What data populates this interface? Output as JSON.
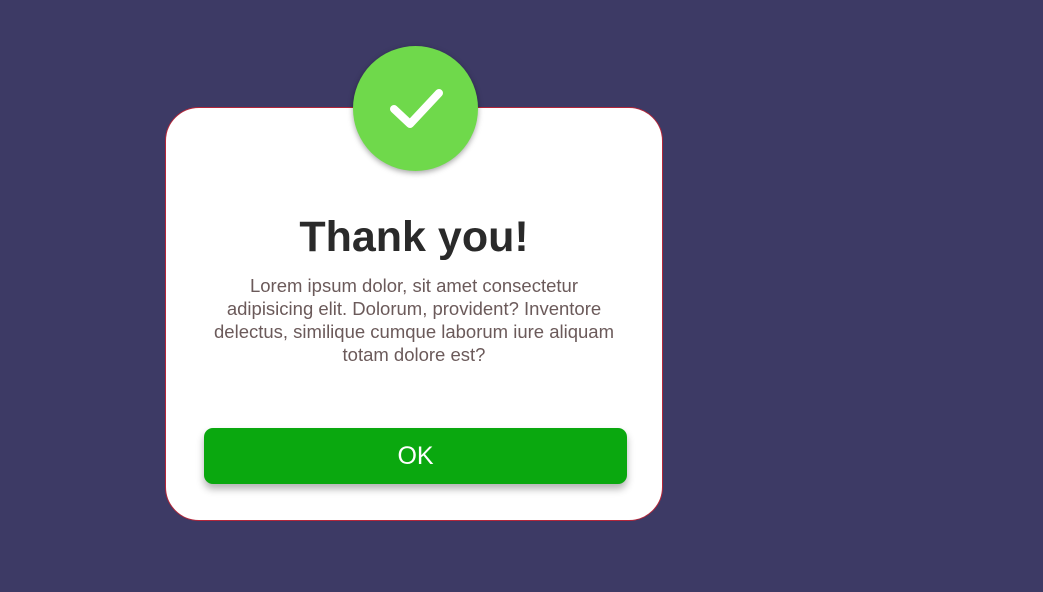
{
  "dialog": {
    "icon": "checkmark-icon",
    "title": "Thank you!",
    "message": "Lorem ipsum dolor, sit amet consectetur adipisicing elit. Dolorum, provident? Inventore delectus, similique cumque laborum iure aliquam totam dolore est?",
    "ok_label": "OK"
  },
  "colors": {
    "background": "#3d3a65",
    "badge": "#6fd94b",
    "button": "#0aa80f",
    "border": "#b3263a"
  }
}
